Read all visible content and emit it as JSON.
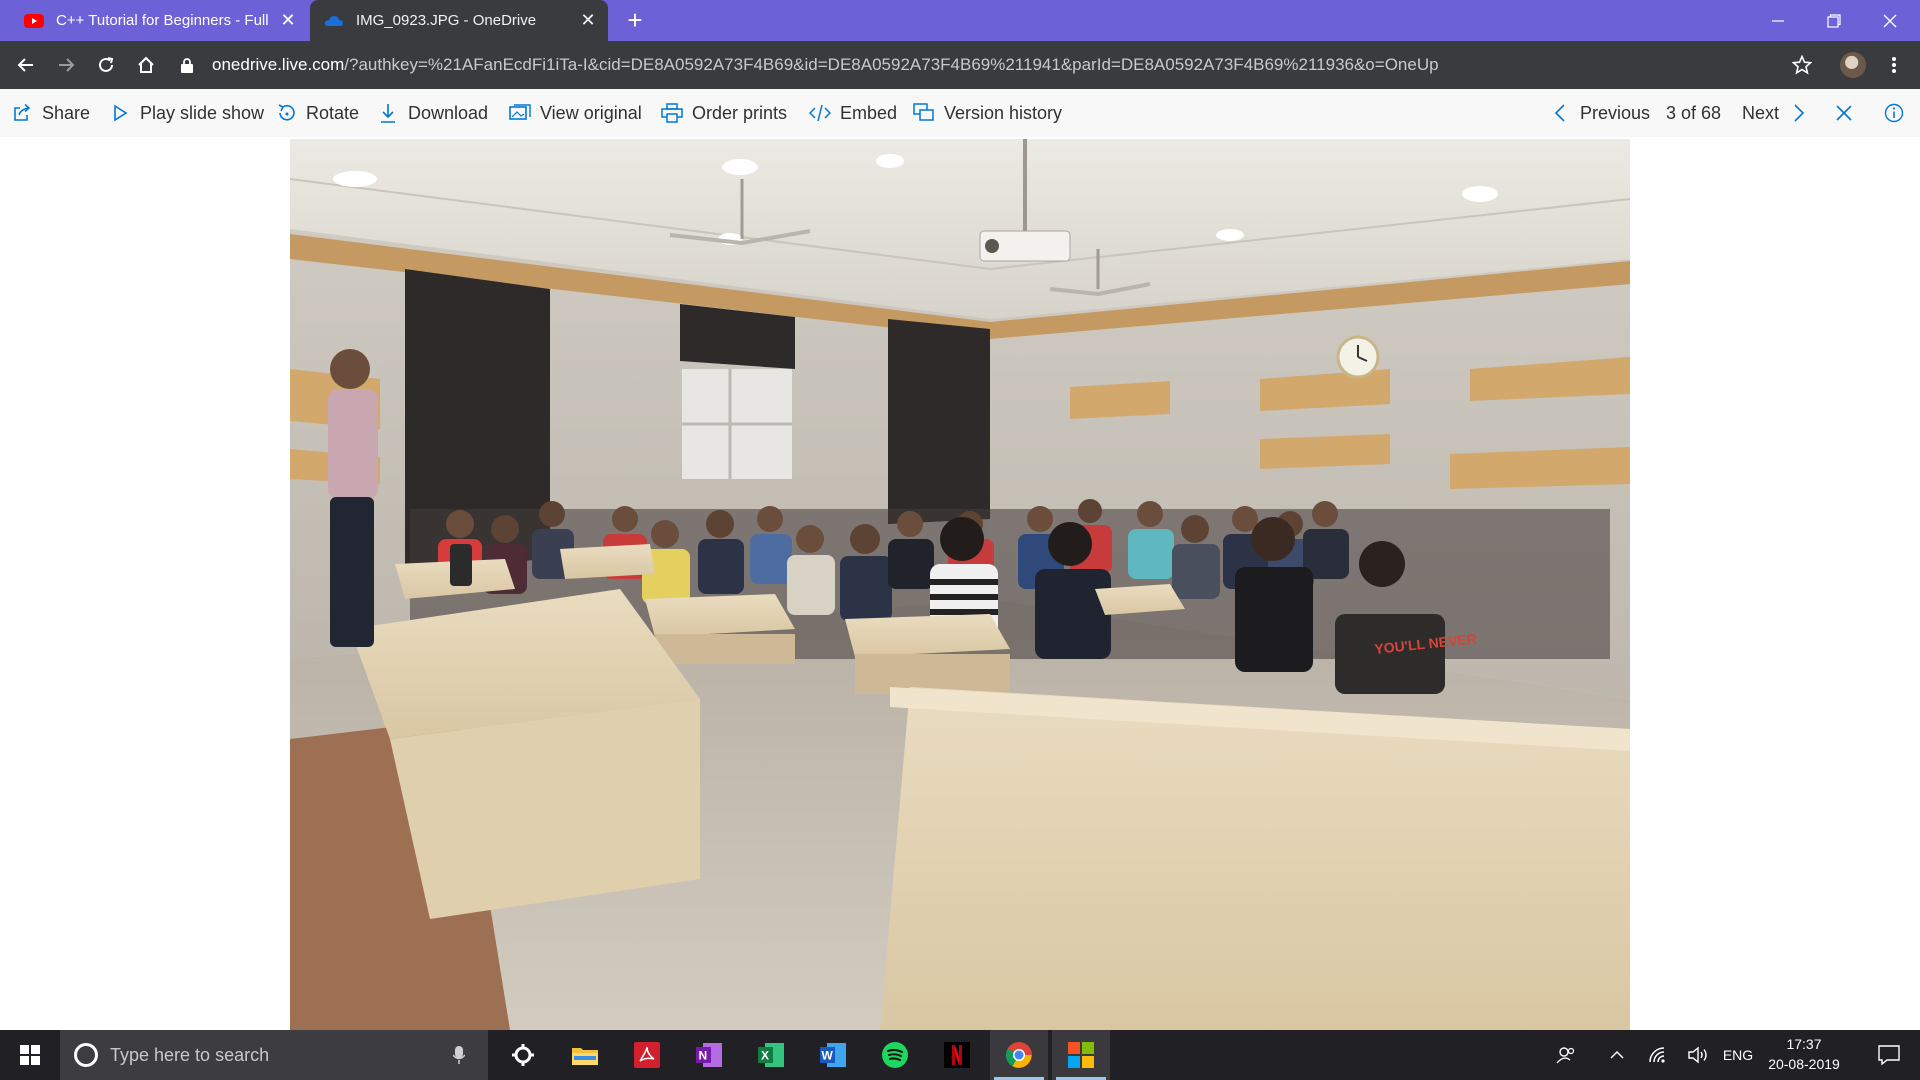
{
  "browser": {
    "tabs": [
      {
        "title": "C++ Tutorial for Beginners - Full",
        "favicon": "youtube-icon",
        "active": false
      },
      {
        "title": "IMG_0923.JPG - OneDrive",
        "favicon": "onedrive-icon",
        "active": true
      }
    ],
    "url_host": "onedrive.live.com",
    "url_rest": "/?authkey=%21AFanEcdFi1iTa-I&cid=DE8A0592A73F4B69&id=DE8A0592A73F4B69%211941&parId=DE8A0592A73F4B69%211936&o=OneUp"
  },
  "commandbar": {
    "share": "Share",
    "slideshow": "Play slide show",
    "rotate": "Rotate",
    "download": "Download",
    "view_original": "View original",
    "order_prints": "Order prints",
    "embed": "Embed",
    "version_history": "Version history",
    "previous": "Previous",
    "counter": "3 of 68",
    "next": "Next"
  },
  "photo": {
    "shirt_text": "YOU'LL NEVER WALK ALONE"
  },
  "taskbar": {
    "search_placeholder": "Type here to search",
    "apps": [
      "settings-icon",
      "file-explorer-icon",
      "acrobat-icon",
      "onenote-icon",
      "excel-icon",
      "word-icon",
      "spotify-icon",
      "netflix-icon",
      "chrome-icon",
      "app-grid-icon"
    ],
    "language": "ENG",
    "time": "17:37",
    "date": "20-08-2019"
  },
  "colors": {
    "tabstrip": "#6d61d8",
    "toolbar": "#3a3b3f",
    "commandbar": "#f8f8f8",
    "accent": "#0078d4",
    "taskbar": "#212125"
  }
}
